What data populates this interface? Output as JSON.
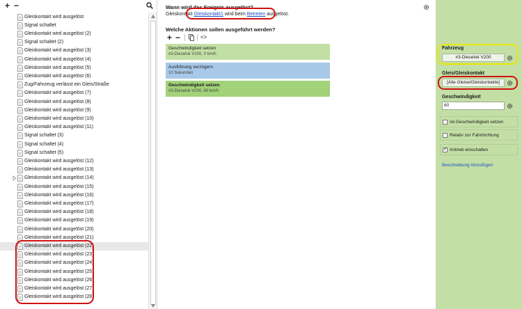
{
  "toolbar": {
    "add": "+",
    "remove": "−"
  },
  "tree": {
    "items": [
      "Gleiskontakt wird ausgelöst",
      "Signal schaltet",
      "Gleiskontakt wird ausgelöst (2)",
      "Signal schaltet (2)",
      "Gleiskontakt wird ausgelöst (3)",
      "Gleiskontakt wird ausgelöst (4)",
      "Gleiskontakt wird ausgelöst (5)",
      "Gleiskontakt wird ausgelöst (6)",
      "Zug/Fahrzeug verlässt ein Gleis/Straße",
      "Gleiskontakt wird ausgelöst (7)",
      "Gleiskontakt wird ausgelöst (8)",
      "Gleiskontakt wird ausgelöst (9)",
      "Gleiskontakt wird ausgelöst (10)",
      "Gleiskontakt wird ausgelöst (11)",
      "Signal schaltet (3)",
      "Signal schaltet (4)",
      "Signal schaltet (5)",
      "Gleiskontakt wird ausgelöst (12)",
      "Gleiskontakt wird ausgelöst (13)",
      "Gleiskontakt wird ausgelöst (14)",
      "Gleiskontakt wird ausgelöst (15)",
      "Gleiskontakt wird ausgelöst (16)",
      "Gleiskontakt wird ausgelöst (17)",
      "Gleiskontakt wird ausgelöst (18)",
      "Gleiskontakt wird ausgelöst (19)",
      "Gleiskontakt wird ausgelöst (20)",
      "Gleiskontakt wird ausgelöst (21)",
      "Gleiskontakt wird ausgelöst (22)",
      "Gleiskontakt wird ausgelöst (23)",
      "Gleiskontakt wird ausgelöst (24)",
      "Gleiskontakt wird ausgelöst (25)",
      "Gleiskontakt wird ausgelöst (26)",
      "Gleiskontakt wird ausgelöst (27)",
      "Gleiskontakt wird ausgelöst (28)"
    ],
    "selected_index": 27,
    "expandable_index": 19
  },
  "event": {
    "title": "Wann wird das Ereignis ausgelöst?",
    "prefix": "Gleiskontakt",
    "contact_link": "Gleiskontakt1",
    "middle": "wird beim",
    "trigger_link": "Betreten",
    "suffix": "ausgelöst."
  },
  "actions": {
    "title": "Welche Aktionen sollen ausgeführt werden?",
    "add": "+",
    "remove": "−",
    "code": "<>",
    "items": [
      {
        "title": "Geschwindigkeit setzen",
        "subtitle": "#3-Dieselok V200, 0 km/h",
        "color": "#c3e0a4",
        "bold": false
      },
      {
        "title": "Ausführung verzögern",
        "subtitle": "10 Sekunden",
        "color": "#a8c8e8",
        "bold": false
      },
      {
        "title": "Geschwindigkeit setzen",
        "subtitle": "#3-Dieselok V200, 60 km/h",
        "color": "#a2d27a",
        "bold": true
      }
    ]
  },
  "properties": {
    "vehicle_label": "Fahrzeug",
    "vehicle_value": "#3-Dieselok V200",
    "track_label": "Gleis/Gleiskontakt",
    "track_value": "[Alle Gleise/Gleiskontakte]",
    "speed_label": "Geschwindigkeit",
    "speed_value": "60",
    "options": [
      {
        "label": "Ist-Geschwindigkeit setzen",
        "checked": false
      },
      {
        "label": "Relativ zur Fahrtrichtung",
        "checked": false
      },
      {
        "label": "Antrieb einschalten",
        "checked": true
      }
    ],
    "description_link": "Beschreibung hinzufügen"
  },
  "colors": {
    "right_panel": "#c3dfa6",
    "annotation_red": "#d01010",
    "annotation_yellow": "#e8e800",
    "link": "#1a4fc4"
  }
}
